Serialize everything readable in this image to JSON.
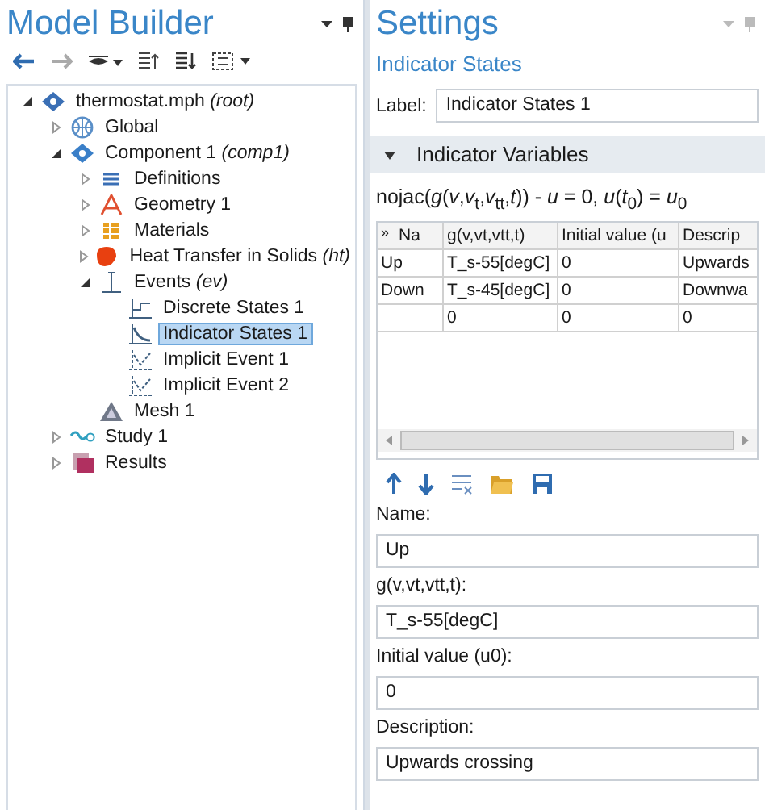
{
  "model_builder": {
    "title": "Model Builder",
    "tree": [
      {
        "label": "thermostat.mph *(root)*",
        "kind": "model",
        "expanded": true,
        "selected": false,
        "children": [
          {
            "label": "Global",
            "kind": "globe",
            "expanded": false,
            "selected": false
          },
          {
            "label": "Component 1 *(comp1)*",
            "kind": "component",
            "expanded": true,
            "selected": false,
            "children": [
              {
                "label": "Definitions",
                "kind": "definitions",
                "expanded": false,
                "selected": false
              },
              {
                "label": "Geometry 1",
                "kind": "geometry",
                "expanded": false,
                "selected": false
              },
              {
                "label": "Materials",
                "kind": "materials",
                "expanded": false,
                "selected": false
              },
              {
                "label": "Heat Transfer in Solids *(ht)*",
                "kind": "heat",
                "expanded": false,
                "selected": false
              },
              {
                "label": "Events *(ev)*",
                "kind": "events",
                "expanded": true,
                "selected": false,
                "children": [
                  {
                    "label": "Discrete States 1",
                    "kind": "discrete",
                    "selected": false
                  },
                  {
                    "label": "Indicator States 1",
                    "kind": "indicator",
                    "selected": true
                  },
                  {
                    "label": "Implicit Event 1",
                    "kind": "implicit",
                    "selected": false
                  },
                  {
                    "label": "Implicit Event 2",
                    "kind": "implicit",
                    "selected": false
                  }
                ]
              },
              {
                "label": "Mesh 1",
                "kind": "mesh",
                "selected": false
              }
            ]
          },
          {
            "label": "Study 1",
            "kind": "study",
            "expanded": false,
            "selected": false
          },
          {
            "label": "Results",
            "kind": "results",
            "expanded": false,
            "selected": false
          }
        ]
      }
    ]
  },
  "settings": {
    "title": "Settings",
    "subtitle": "Indicator States",
    "label_caption": "Label:",
    "label_value": "Indicator States 1",
    "section": {
      "title": "Indicator Variables",
      "expanded": true
    },
    "equation": "nojac(*g*(*v*,*v*$_{t}$,*v*$_{tt}$,*t*)) - *u* = 0,  *u*(*t*$_{0}$) = *u*$_{0}$",
    "table": {
      "header_marker": "»",
      "columns": [
        "Na",
        "g(v,vt,vtt,t)",
        "Initial value (u",
        "Descrip"
      ],
      "rows": [
        [
          "Up",
          "T_s-55[degC]",
          "0",
          "Upwards"
        ],
        [
          "Down",
          "T_s-45[degC]",
          "0",
          "Downwa"
        ],
        [
          "",
          "0",
          "0",
          "0"
        ]
      ]
    },
    "fields": [
      {
        "label": "Name:",
        "value": "Up"
      },
      {
        "label": "g(v,vt,vtt,t):",
        "value": "T_s-55[degC]"
      },
      {
        "label": "Initial value (u0):",
        "value": "0"
      },
      {
        "label": "Description:",
        "value": "Upwards crossing"
      }
    ]
  }
}
